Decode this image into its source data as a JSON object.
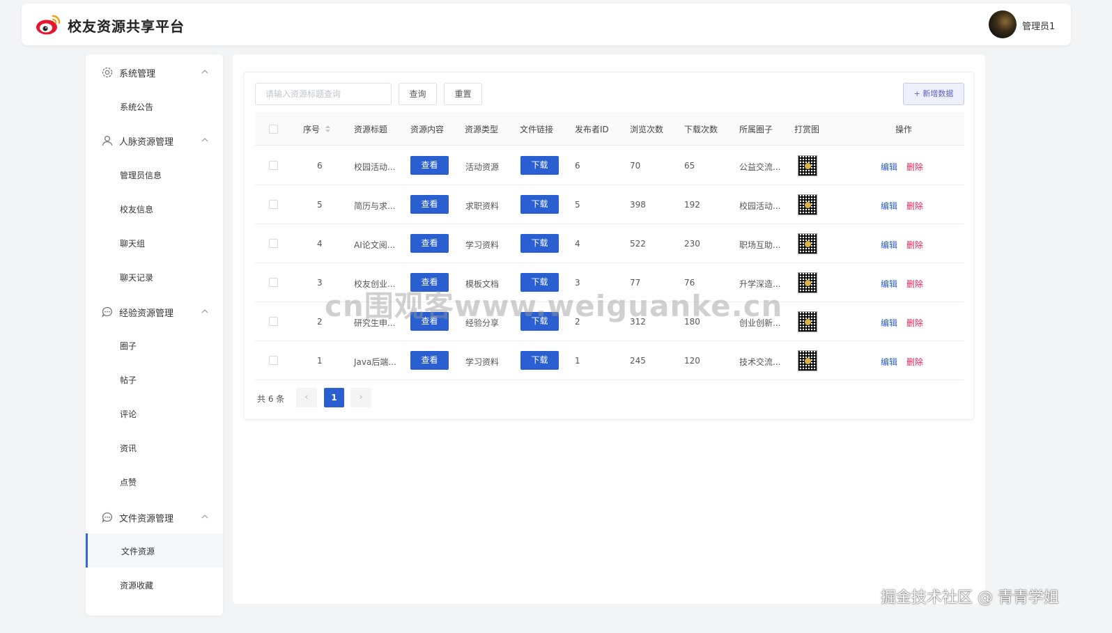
{
  "header": {
    "app_title": "校友资源共享平台",
    "user_name": "管理员1",
    "logo_icon": "weibo-logo-icon",
    "brand_color": "#e6162d"
  },
  "sidebar": {
    "groups": [
      {
        "label": "系统管理",
        "icon": "gear-icon",
        "items": [
          "系统公告"
        ]
      },
      {
        "label": "人脉资源管理",
        "icon": "user-icon",
        "items": [
          "管理员信息",
          "校友信息",
          "聊天组",
          "聊天记录"
        ]
      },
      {
        "label": "经验资源管理",
        "icon": "chat-bubble-icon",
        "items": [
          "圈子",
          "帖子",
          "评论",
          "资讯",
          "点赞"
        ]
      },
      {
        "label": "文件资源管理",
        "icon": "chat-bubble-icon",
        "items": [
          "文件资源",
          "资源收藏"
        ]
      }
    ],
    "active_item": "文件资源"
  },
  "toolbar": {
    "search_placeholder": "请输入资源标题查询",
    "query_label": "查询",
    "reset_label": "重置",
    "add_label": "+ 新增数据"
  },
  "table": {
    "columns": [
      "序号",
      "资源标题",
      "资源内容",
      "资源类型",
      "文件链接",
      "发布者ID",
      "浏览次数",
      "下载次数",
      "所属圈子",
      "打赏图",
      "操作"
    ],
    "view_label": "查看",
    "download_label": "下载",
    "edit_label": "编辑",
    "delete_label": "删除",
    "rows": [
      {
        "no": "6",
        "title": "校园活动...",
        "type": "活动资源",
        "publisher": "6",
        "views": "70",
        "downloads": "65",
        "circle": "公益交流..."
      },
      {
        "no": "5",
        "title": "简历与求...",
        "type": "求职资料",
        "publisher": "5",
        "views": "398",
        "downloads": "192",
        "circle": "校园活动..."
      },
      {
        "no": "4",
        "title": "AI论文阅...",
        "type": "学习资料",
        "publisher": "4",
        "views": "522",
        "downloads": "230",
        "circle": "职场互助..."
      },
      {
        "no": "3",
        "title": "校友创业...",
        "type": "模板文档",
        "publisher": "3",
        "views": "77",
        "downloads": "76",
        "circle": "升学深造..."
      },
      {
        "no": "2",
        "title": "研究生申...",
        "type": "经验分享",
        "publisher": "2",
        "views": "312",
        "downloads": "180",
        "circle": "创业创新..."
      },
      {
        "no": "1",
        "title": "Java后端...",
        "type": "学习资料",
        "publisher": "1",
        "views": "245",
        "downloads": "120",
        "circle": "技术交流..."
      }
    ]
  },
  "pagination": {
    "total_text": "共 6 条",
    "prev": "‹",
    "current_page": "1",
    "next": "›"
  },
  "overlay": {
    "watermark": "cn围观客www.weiguanke.cn",
    "credit": "掘金技术社区 @ 青青学姐"
  },
  "colors": {
    "primary": "#2a5fd1",
    "danger": "#e0245e",
    "background": "#f3f4f6"
  }
}
